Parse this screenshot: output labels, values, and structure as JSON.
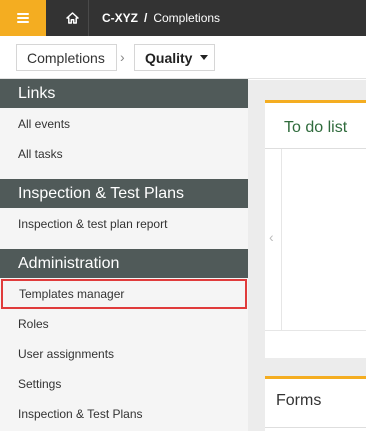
{
  "topbar": {
    "menu_icon": "hamburger-menu-icon",
    "home_icon": "home-icon",
    "breadcrumb": {
      "project": "C-XYZ",
      "separator": "/",
      "current": "Completions"
    }
  },
  "subnav": {
    "section": "Completions",
    "module": "Quality"
  },
  "sidebar": {
    "sections": [
      {
        "title": "Links",
        "items": [
          "All events",
          "All tasks"
        ]
      },
      {
        "title": "Inspection & Test Plans",
        "items": [
          "Inspection & test plan report"
        ]
      },
      {
        "title": "Administration",
        "items": [
          "Templates manager",
          "Roles",
          "User assignments",
          "Settings",
          "Inspection & Test Plans"
        ]
      }
    ]
  },
  "main": {
    "todo_title": "To do list",
    "forms_title": "Forms"
  },
  "colors": {
    "accent": "#f4ad21",
    "topbar": "#333333",
    "section_header": "#505a59",
    "highlight": "#e03b3b",
    "title_green": "#2f6b3c"
  }
}
